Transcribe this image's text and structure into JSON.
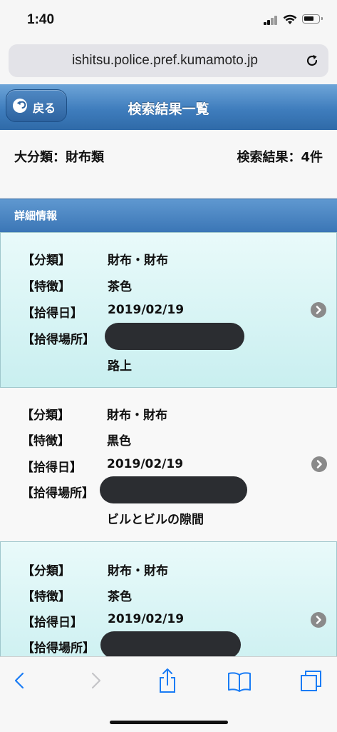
{
  "status": {
    "time": "1:40"
  },
  "browser": {
    "url": "ishitsu.police.pref.kumamoto.jp"
  },
  "header": {
    "back_label": "戻る",
    "title": "検索結果一覧"
  },
  "summary": {
    "category": "大分類：財布類",
    "result_count": "検索結果：4件"
  },
  "section": {
    "title": "詳細情報"
  },
  "results": [
    {
      "class_key": "【分類】",
      "class_val": "財布・財布",
      "feature_key": "【特徴】",
      "feature_val": "茶色",
      "date_key": "【拾得日】",
      "date_val": "2019/02/19",
      "place_key": "【拾得場所】",
      "place_detail": "路上"
    },
    {
      "class_key": "【分類】",
      "class_val": "財布・財布",
      "feature_key": "【特徴】",
      "feature_val": "黒色",
      "date_key": "【拾得日】",
      "date_val": "2019/02/19",
      "place_key": "【拾得場所】",
      "place_detail": "ビルとビルの隙間"
    },
    {
      "class_key": "【分類】",
      "class_val": "財布・財布",
      "feature_key": "【特徴】",
      "feature_val": "茶色",
      "date_key": "【拾得日】",
      "date_val": "2019/02/19",
      "place_key": "【拾得場所】",
      "place_detail": ""
    }
  ],
  "icons": {
    "back": "back-arrow-circle-icon",
    "detail": "chevron-right-circle-icon",
    "toolbar": [
      "back-icon",
      "forward-icon",
      "share-icon",
      "bookmarks-icon",
      "tabs-icon"
    ]
  },
  "colors": {
    "accent": "#3f7dbd",
    "toolbar_tint": "#1a7cf5",
    "item_highlight": "#c9eff0"
  }
}
